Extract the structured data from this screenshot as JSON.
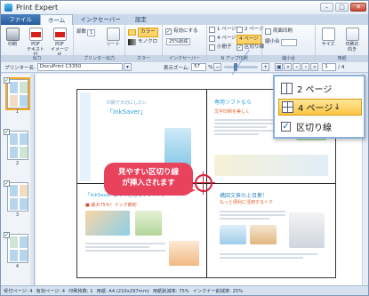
{
  "app": {
    "title": "Print Expert",
    "window_controls": [
      "–",
      "□",
      "✕"
    ]
  },
  "ribbon": {
    "tabs": [
      "ファイル",
      "ホーム",
      "インクセーバー",
      "設定"
    ],
    "active_tab": "ホーム",
    "output_group": {
      "label": "出力",
      "print_label": "印刷",
      "pdf_text_label": "PDF\nテキスト付",
      "pdf_image_label": "PDF\nイメージ化"
    },
    "printer_group": {
      "label": "プリンター出力",
      "copies_label": "部数",
      "copies_value": "1",
      "sort_label": "ソート"
    },
    "color_group": {
      "label": "カラー",
      "color_label": "カラー",
      "mono_label": "モノクロ"
    },
    "inksaver_group": {
      "label": "インクセーバー",
      "enable_label": "有効にする",
      "reduction_value": "25%削減"
    },
    "layout_group": {
      "label": "N アップ印刷",
      "one_page": "1 ページ",
      "two_page": "2 ページ",
      "four_page": "4 ページ",
      "small_label": "小冊子",
      "cut_line": "区切り線"
    },
    "margin_group": {
      "label": "縮小合",
      "both_sides": "両面印刷",
      "fit_label": "縮小合",
      "booklet": "小冊子"
    },
    "paper_group": {
      "label": "用紙",
      "size_label": "サイズ",
      "orientation_label": "印刷の\n向き"
    }
  },
  "toolbar": {
    "printer_label": "プリンター名:",
    "printer_value": "DocuPrint C3350",
    "zoom_label": "表示ズーム:",
    "zoom_value": "57",
    "zoom_unit": "%",
    "zoom_level": 0.57,
    "page_value": "1",
    "page_total": "/ 4"
  },
  "thumbnails": [
    {
      "num": "1",
      "checked": true,
      "selected": true
    },
    {
      "num": "2",
      "checked": true,
      "selected": false
    },
    {
      "num": "3",
      "checked": true,
      "selected": false
    },
    {
      "num": "4",
      "checked": true,
      "selected": false
    }
  ],
  "preview": {
    "q1_heading": "「InkSaver」",
    "q1_sub": "印刷で大切にしたい",
    "q2_heading": "専用ソフトなら",
    "q2_sub": "文字印刷を美しく",
    "q3_heading": "「InkSaver はってどんなソフト？」",
    "q3_sub": "■ 最大75％！インク節約",
    "q4_heading": "構図文章の上目集！",
    "q4_sub": "もっと便利に活用するトク",
    "callout_text": "見やすい区切り線\nが挿入されます"
  },
  "popout": {
    "two_page": "2 ページ",
    "four_page": "4 ページ",
    "four_arrow": "↓",
    "cut_line": "区切り線",
    "cut_line_checked": true
  },
  "status": {
    "items": [
      "受付ページ: 4",
      "有効ページ: 4",
      "印刷枚数: 1",
      "用紙: A4 (210x297mm)",
      "用紙削減率: 75%",
      "インクナー削減率: 25%"
    ]
  },
  "colors": {
    "accent_file_tab": "#2a5c9e",
    "callout": "#e8425d",
    "cut_marker": "#d62039",
    "selection": "#fbc545",
    "inksaver_blue": "#2ea0dc"
  }
}
